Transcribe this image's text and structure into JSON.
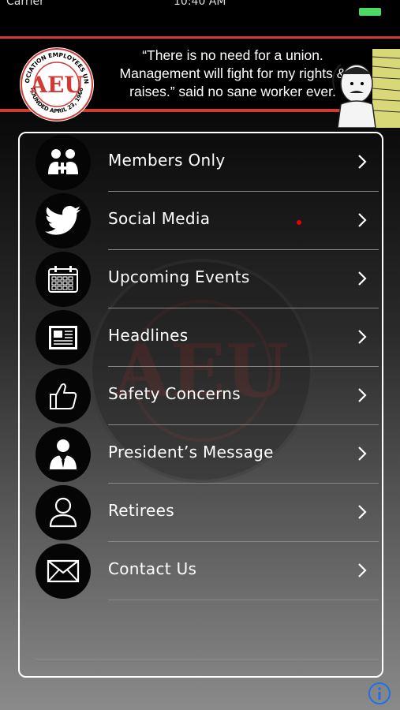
{
  "status_bar": {
    "carrier": "Carrier",
    "time": "10:40 AM"
  },
  "banner": {
    "logo_text": "AEU",
    "logo_ring_top": "ASSOCIATION EMPLOYEES UNION",
    "logo_ring_bottom": "FOUNDED APRIL 23, 1968",
    "quote": "“There is no need for a union. Management will fight for my rights & raises.” said no sane worker ever."
  },
  "menu": {
    "items": [
      {
        "label": "Members Only",
        "icon": "members-icon"
      },
      {
        "label": "Social Media",
        "icon": "twitter-bird-icon"
      },
      {
        "label": "Upcoming Events",
        "icon": "calendar-icon"
      },
      {
        "label": "Headlines",
        "icon": "newspaper-icon"
      },
      {
        "label": "Safety Concerns",
        "icon": "thumbs-up-icon"
      },
      {
        "label": "President’s Message",
        "icon": "businessman-icon"
      },
      {
        "label": "Retirees",
        "icon": "person-outline-icon"
      },
      {
        "label": "Contact Us",
        "icon": "envelope-icon"
      }
    ]
  },
  "colors": {
    "accent_red": "#d23a35",
    "battery_green": "#4cd964",
    "info_blue": "#1a73e8"
  }
}
